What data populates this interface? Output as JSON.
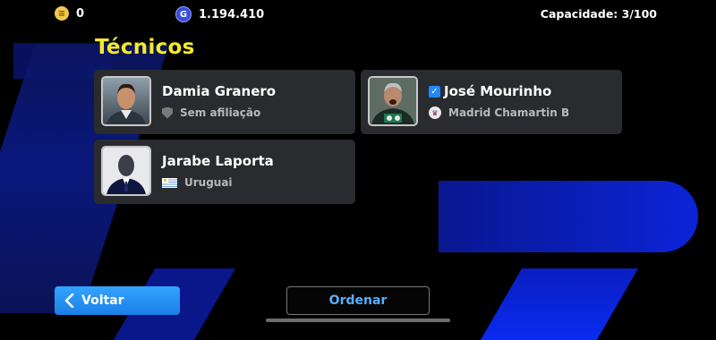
{
  "currency": {
    "gp_amount": "0",
    "gc_icon_letter": "G",
    "gc_amount": "1.194.410"
  },
  "capacity_text": "Capacidade: 3/100",
  "section_title": "Técnicos",
  "managers": [
    {
      "name": "Damia Granero",
      "affiliation": "Sem afiliação",
      "affiliation_icon": "shield-icon",
      "verified": false
    },
    {
      "name": "José Mourinho",
      "affiliation": "Madrid Chamartin B",
      "affiliation_icon": "club-crest-icon",
      "verified": true
    },
    {
      "name": "Jarabe Laporta",
      "affiliation": "Uruguai",
      "affiliation_icon": "uruguay-flag-icon",
      "verified": false
    }
  ],
  "buttons": {
    "back_label": "Voltar",
    "sort_label": "Ordenar"
  },
  "colors": {
    "title_yellow": "#f4ea2a",
    "back_button_blue": "#1a7fe6",
    "sort_text_blue": "#5aaeff",
    "card_bg": "#2a2b2e"
  }
}
